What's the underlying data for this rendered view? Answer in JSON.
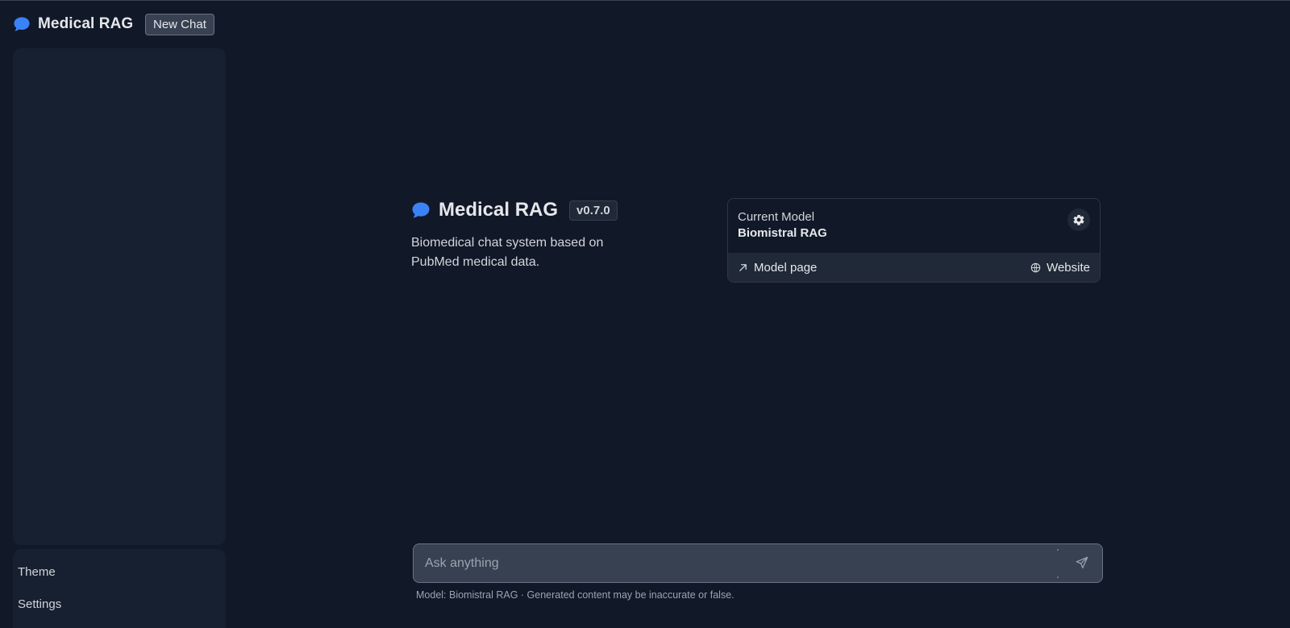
{
  "header": {
    "brand_title": "Medical RAG",
    "brand_icon": "chat-bubble-icon",
    "new_chat_label": "New Chat"
  },
  "sidebar": {
    "theme_label": "Theme",
    "settings_label": "Settings"
  },
  "intro": {
    "title": "Medical RAG",
    "version": "v0.7.0",
    "description": "Biomedical chat system based on PubMed medical data."
  },
  "model_card": {
    "label": "Current Model",
    "name": "Biomistral RAG",
    "settings_icon": "gear-icon",
    "model_page_label": "Model page",
    "model_page_icon": "arrow-up-right-icon",
    "website_label": "Website",
    "website_icon": "globe-icon"
  },
  "chat": {
    "placeholder": "Ask anything",
    "send_icon": "send-icon"
  },
  "footer": {
    "disclaimer": "Model: Biomistral RAG · Generated content may be inaccurate or false."
  },
  "colors": {
    "background": "#111827",
    "accent": "#3b82f6",
    "panel": "#172030",
    "input": "#374151"
  }
}
